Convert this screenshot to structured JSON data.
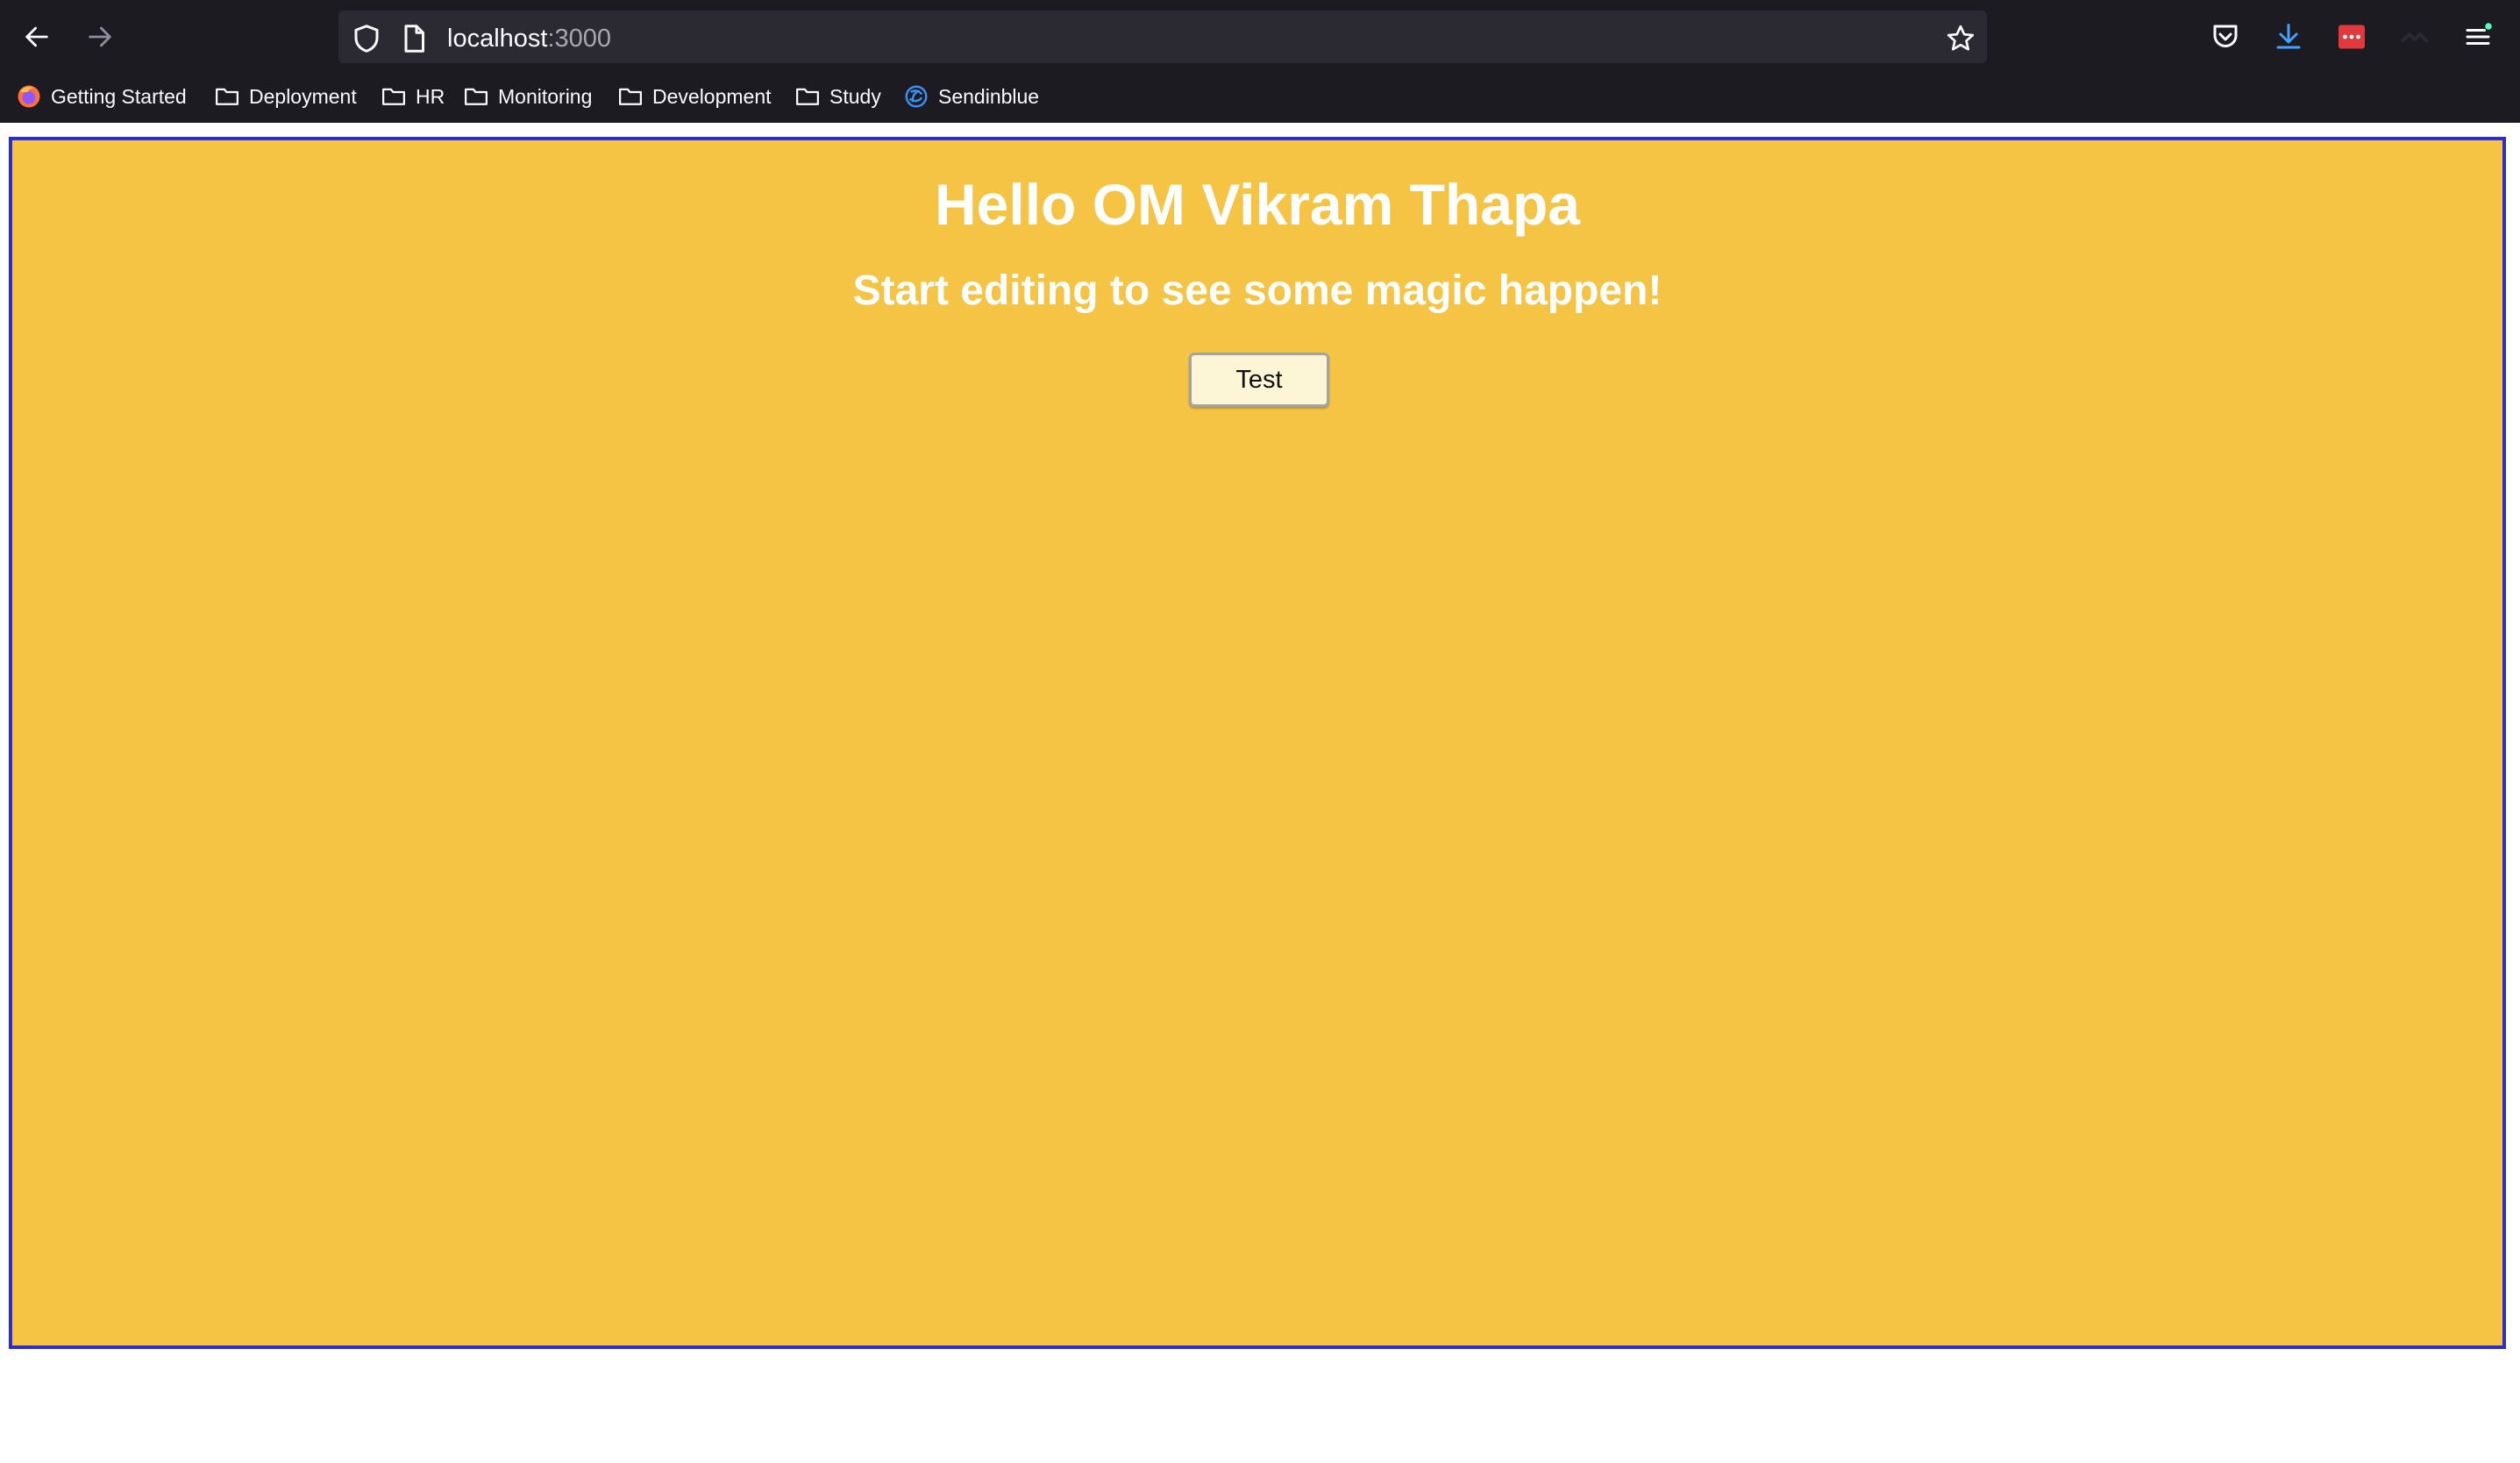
{
  "browser": {
    "url_host": "localhost",
    "url_port": ":3000",
    "bookmarks": [
      {
        "label": "Getting Started",
        "icon": "firefox-icon"
      },
      {
        "label": "Deployment",
        "icon": "folder-icon"
      },
      {
        "label": "HR",
        "icon": "folder-icon"
      },
      {
        "label": "Monitoring",
        "icon": "folder-icon"
      },
      {
        "label": "Development",
        "icon": "folder-icon"
      },
      {
        "label": "Study",
        "icon": "folder-icon"
      },
      {
        "label": "Sendinblue",
        "icon": "sendinblue-icon"
      }
    ]
  },
  "page": {
    "title": "Hello OM Vikram Thapa",
    "subtitle": "Start editing to see some magic happen!",
    "button_label": "Test"
  },
  "colors": {
    "chrome_bg": "#1c1b22",
    "urlbar_bg": "#2b2a33",
    "page_bg": "#f6c444",
    "frame_border": "#2d2ccc",
    "button_bg": "#fdf6d6"
  }
}
